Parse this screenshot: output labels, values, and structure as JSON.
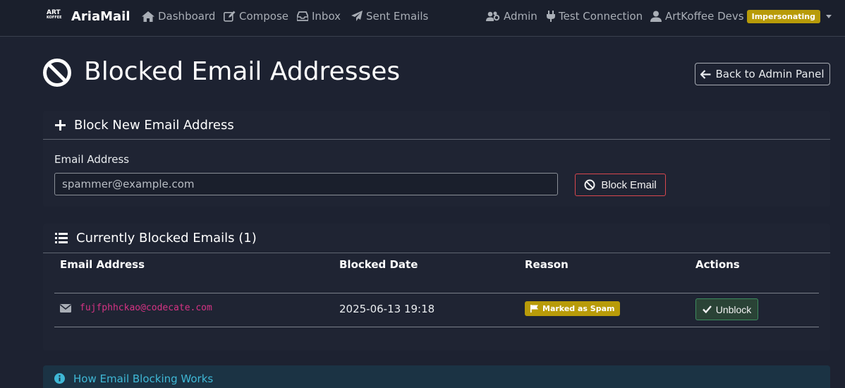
{
  "navbar": {
    "logo_text": "ART",
    "logo_sub": "KOFFEE",
    "brand": "AriaMail",
    "links": [
      {
        "label": "Dashboard",
        "icon": "home-icon"
      },
      {
        "label": "Compose",
        "icon": "edit-icon"
      },
      {
        "label": "Inbox",
        "icon": "inbox-icon"
      },
      {
        "label": "Sent Emails",
        "icon": "paper-plane-icon"
      }
    ],
    "admin_label": "Admin",
    "test_connection_label": "Test Connection",
    "user_label": "ArtKoffee Devs",
    "impersonating_badge": "Impersonating"
  },
  "header": {
    "title": "Blocked Email Addresses",
    "back_button": "Back to Admin Panel"
  },
  "block_form": {
    "title": "Block New Email Address",
    "field_label": "Email Address",
    "placeholder": "spammer@example.com",
    "value": "",
    "submit_label": "Block Email"
  },
  "blocked_list": {
    "title": "Currently Blocked Emails (1)",
    "columns": [
      "Email Address",
      "Blocked Date",
      "Reason",
      "Actions"
    ],
    "rows": [
      {
        "email": "fujfphhckao@codecate.com",
        "blocked_date": "2025-06-13 19:18",
        "reason": "Marked as Spam",
        "action_label": "Unblock"
      }
    ]
  },
  "info": {
    "title": "How Email Blocking Works"
  },
  "colors": {
    "background": "#1d2231",
    "navbar": "#1a1f2c",
    "warning_badge": "#b89b09",
    "danger": "#d9474e",
    "success": "#3d8b5e",
    "info": "#3fb8d6",
    "code_pink": "#d63384"
  }
}
